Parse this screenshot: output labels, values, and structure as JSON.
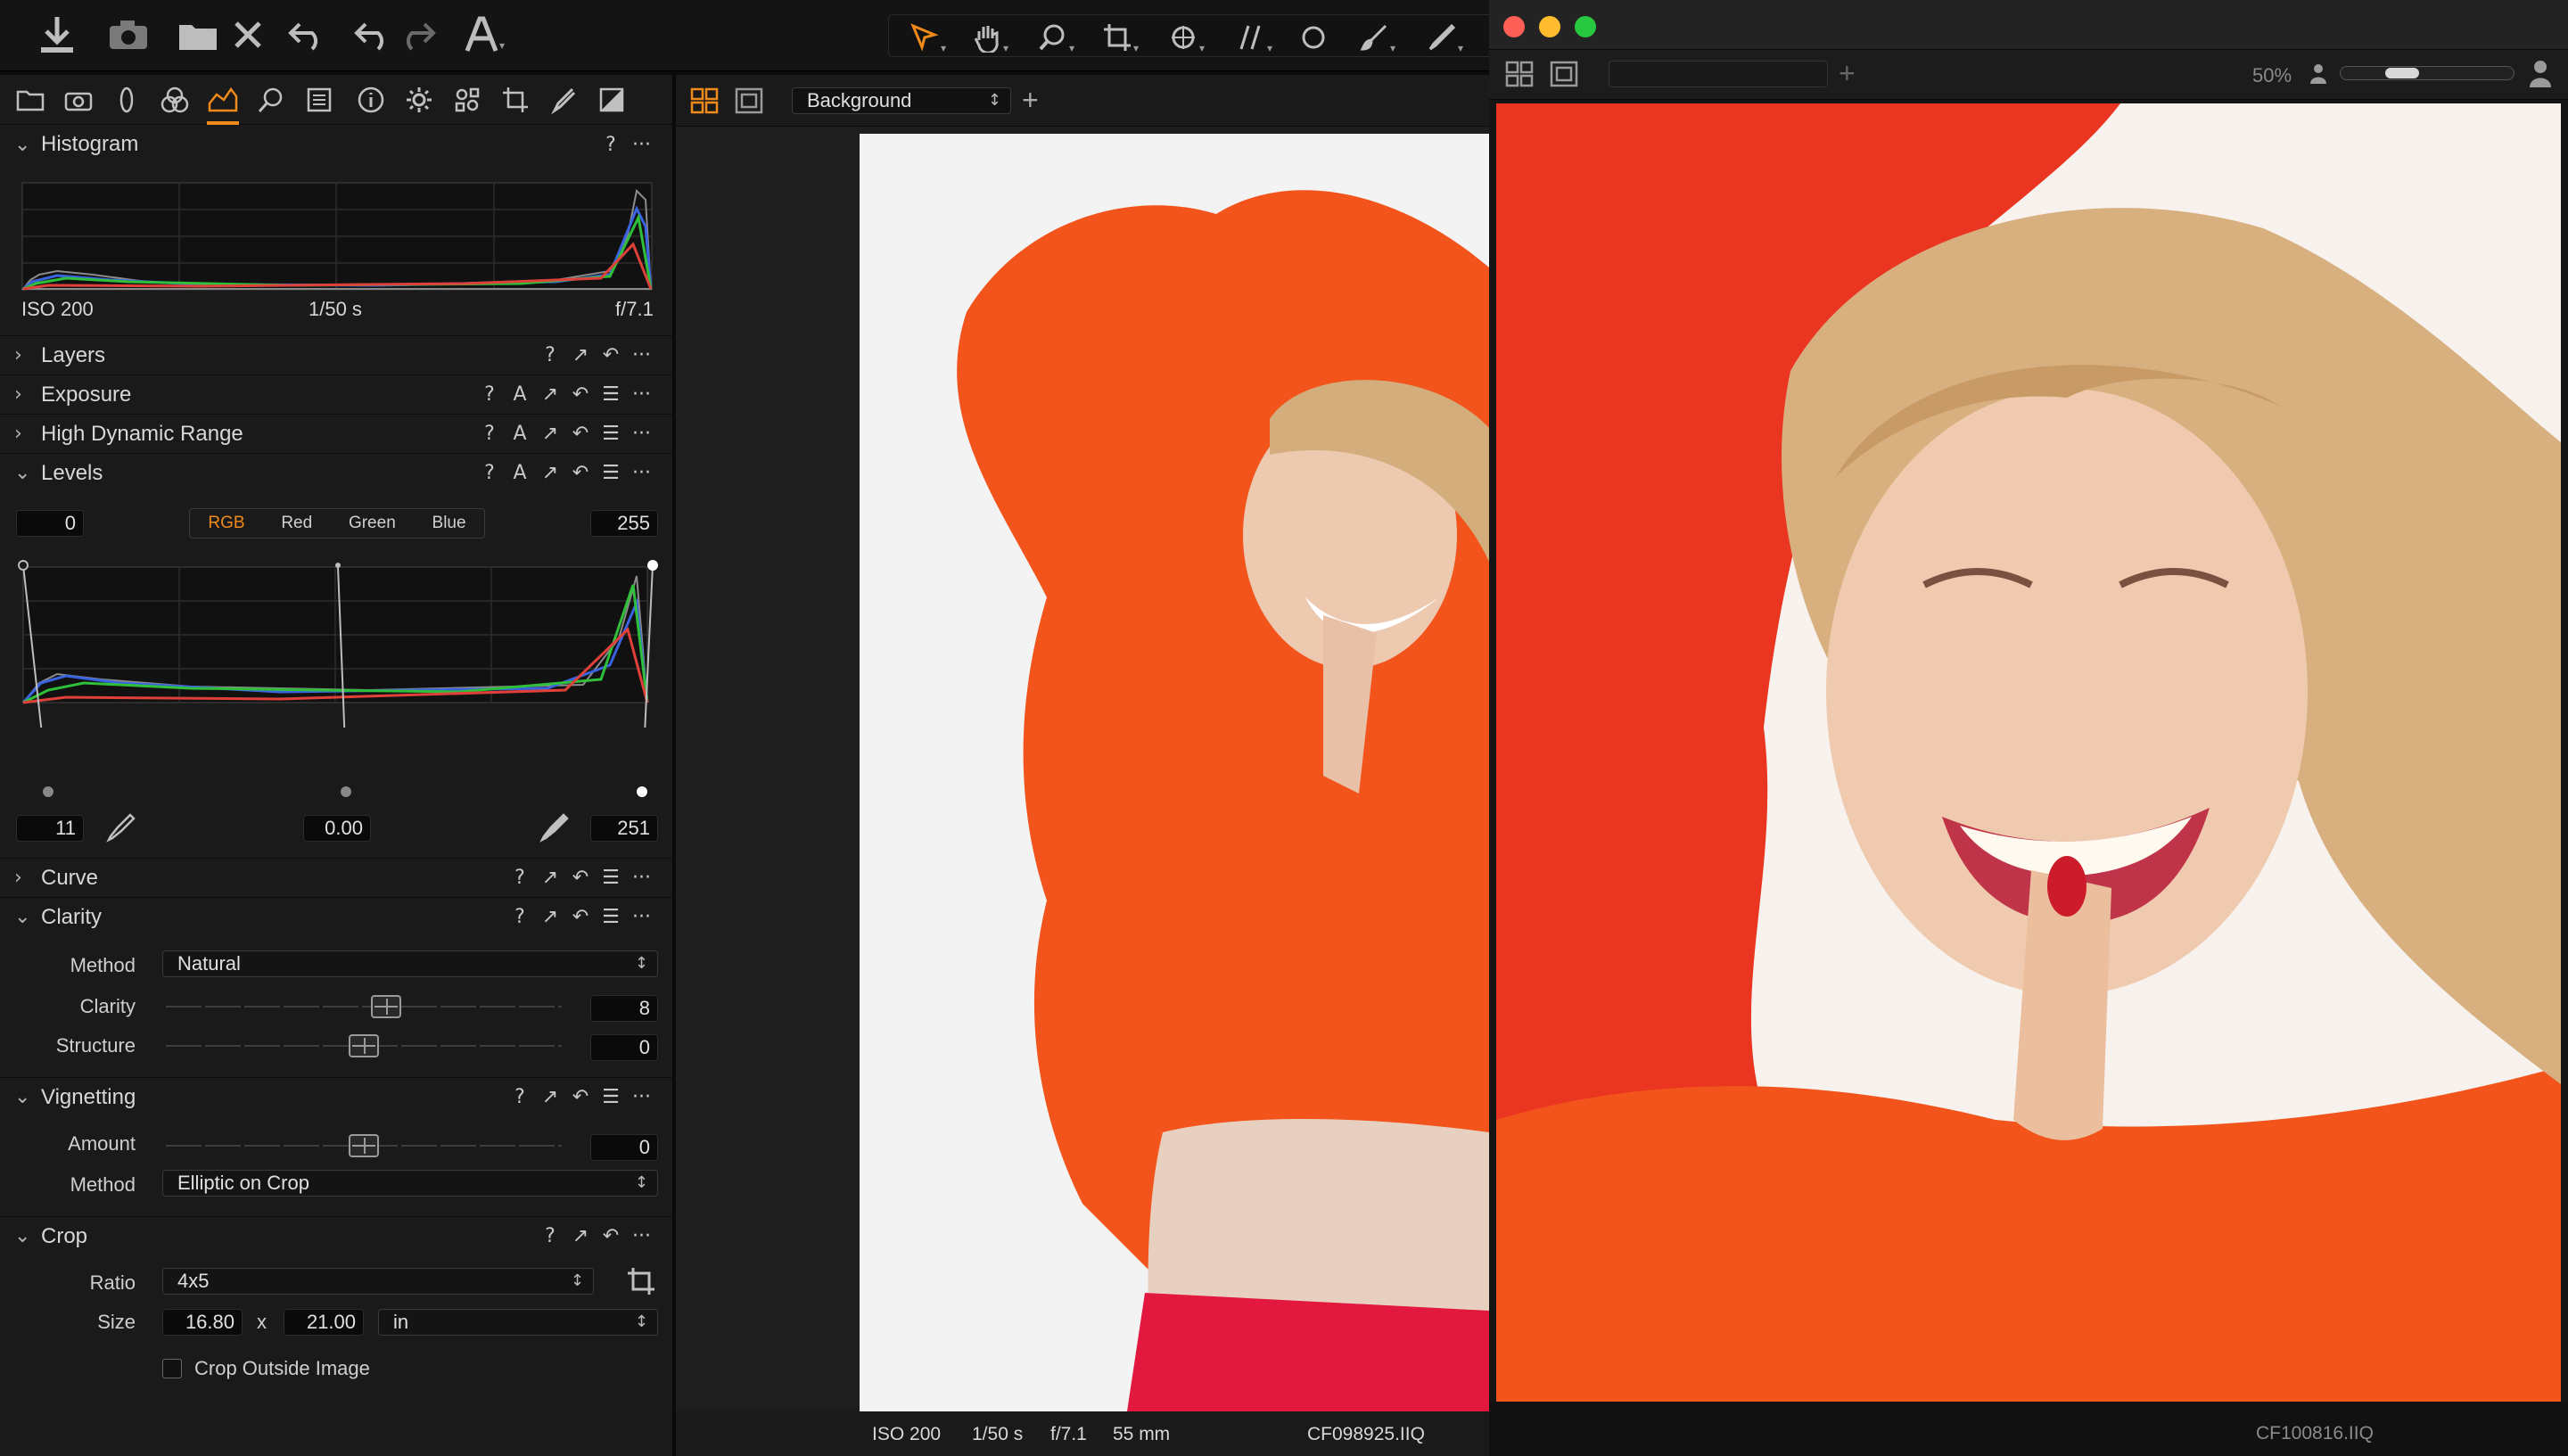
{
  "toolbar": {
    "icons": [
      "import-icon",
      "camera-icon",
      "folder-move-icon",
      "delete-icon",
      "undo-all-icon",
      "undo-icon",
      "redo-icon",
      "text-tool-icon"
    ],
    "cursor_tools": [
      "select-cursor-icon",
      "pan-hand-icon",
      "zoom-icon",
      "crop-tool-icon",
      "rotate-icon",
      "straighten-icon",
      "circle-icon",
      "brush-icon",
      "eraser-pen-icon"
    ]
  },
  "tool_tabs": [
    "library-folder-icon",
    "capture-camera-icon",
    "lens-icon",
    "color-icon",
    "exposure-icon",
    "details-icon",
    "adjustments-list-icon",
    "metadata-info-icon",
    "output-gear-icon",
    "batch-icon",
    "crop-icon",
    "picker-icon",
    "styles-icon"
  ],
  "sections": {
    "histogram": {
      "title": "Histogram",
      "iso": "ISO 200",
      "shutter": "1/50 s",
      "aperture": "f/7.1"
    },
    "layers": {
      "title": "Layers"
    },
    "exposure": {
      "title": "Exposure"
    },
    "hdr": {
      "title": "High Dynamic Range"
    },
    "levels": {
      "title": "Levels",
      "input_low": "0",
      "input_high": "255",
      "channels": [
        "RGB",
        "Red",
        "Green",
        "Blue"
      ],
      "active_channel": "RGB",
      "output_low": "11",
      "midpoint": "0.00",
      "output_high": "251"
    },
    "curve": {
      "title": "Curve"
    },
    "clarity": {
      "title": "Clarity",
      "method_label": "Method",
      "method_value": "Natural",
      "clarity_label": "Clarity",
      "clarity_value": "8",
      "clarity_position": 0.56,
      "structure_label": "Structure",
      "structure_value": "0",
      "structure_position": 0.5
    },
    "vignetting": {
      "title": "Vignetting",
      "amount_label": "Amount",
      "amount_value": "0",
      "amount_position": 0.5,
      "method_label": "Method",
      "method_value": "Elliptic on Crop"
    },
    "crop": {
      "title": "Crop",
      "ratio_label": "Ratio",
      "ratio_value": "4x5",
      "size_label": "Size",
      "width": "16.80",
      "x_separator": "x",
      "height": "21.00",
      "unit": "in",
      "outside_label": "Crop Outside Image",
      "outside_checked": false
    }
  },
  "ctrl_glyphs": {
    "help": "?",
    "auto": "A",
    "copy": "↗",
    "reset": "↶",
    "presets": "☰",
    "more": "···"
  },
  "viewer": {
    "layer_select": "Background",
    "footer": {
      "iso": "ISO 200",
      "shutter": "1/50 s",
      "aperture": "f/7.1",
      "focal": "55 mm",
      "filename": "CF098925.IIQ"
    }
  },
  "window2": {
    "zoom": "50%",
    "filename": "CF100816.IIQ"
  },
  "colors": {
    "accent": "#f08a1a",
    "close": "#fe5f57",
    "minimize": "#febc2e",
    "maximize": "#28c840",
    "fur": "#f2541b"
  }
}
